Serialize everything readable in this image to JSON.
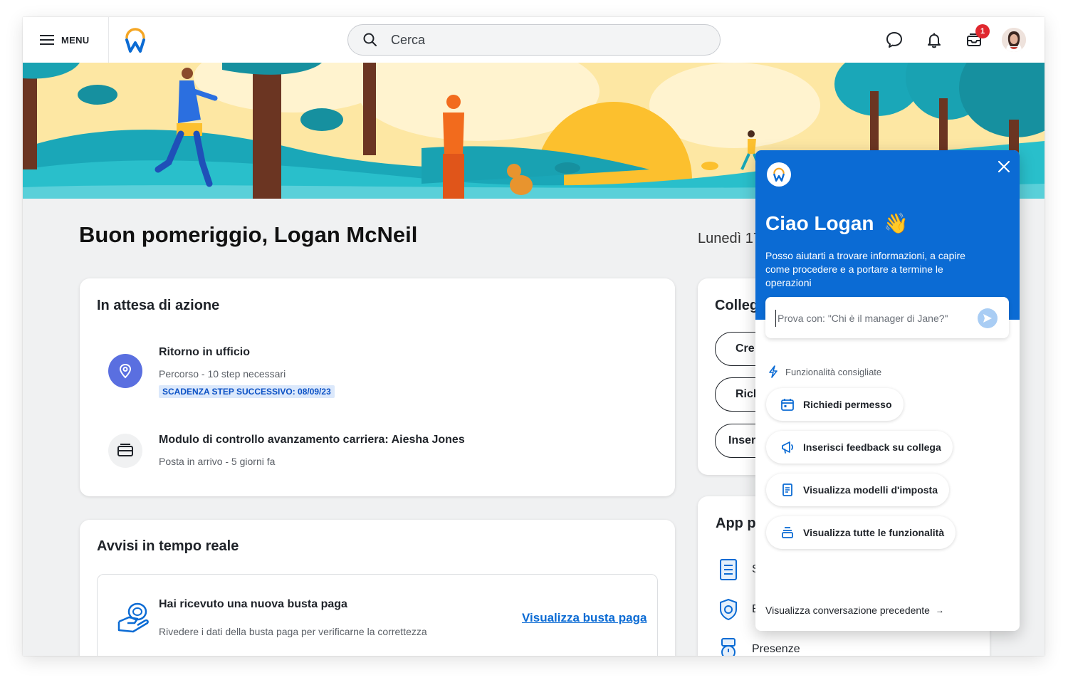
{
  "topbar": {
    "menu_label": "MENU",
    "search_placeholder": "Cerca",
    "inbox_badge": "1"
  },
  "greeting": "Buon pomeriggio, Logan McNeil",
  "date": "Lunedì 17",
  "awaiting": {
    "title": "In attesa di azione",
    "tasks": [
      {
        "title": "Ritorno in ufficio",
        "subtitle": "Percorso - 10 step necessari",
        "deadline": "SCADENZA STEP SUCCESSIVO: 08/09/23"
      },
      {
        "title": "Modulo di controllo avanzamento carriera: Aiesha Jones",
        "subtitle": "Posta in arrivo - 5 giorni fa"
      }
    ]
  },
  "alerts": {
    "title": "Avvisi in tempo reale",
    "items": [
      {
        "title": "Hai ricevuto una nuova busta paga",
        "subtitle": "Rivedere i dati della busta paga per verificarne la correttezza",
        "link": "Visualizza busta paga"
      }
    ]
  },
  "colleagues": {
    "title": "Colleg",
    "buttons": [
      "Cre",
      "Rich",
      "Inser"
    ]
  },
  "apps": {
    "title": "App pr",
    "items": [
      "S",
      "E",
      "Presenze"
    ]
  },
  "assistant": {
    "greeting": "Ciao Logan",
    "wave": "👋",
    "description": "Posso aiutarti a trovare informazioni, a capire come procedere e a portare a termine le operazioni",
    "input_placeholder": "Prova con: \"Chi è il manager di Jane?\"",
    "section_label": "Funzionalità consigliate",
    "chips": [
      {
        "label": "Richiedi permesso",
        "icon": "calendar-icon"
      },
      {
        "label": "Inserisci feedback su collega",
        "icon": "megaphone-icon"
      },
      {
        "label": "Visualizza modelli d'imposta",
        "icon": "document-icon"
      },
      {
        "label": "Visualizza tutte le funzionalità",
        "icon": "stack-icon"
      }
    ],
    "previous_conversation": "Visualizza conversazione precedente",
    "arrow": "→"
  },
  "colors": {
    "brand_blue": "#0b6bd4",
    "banner_sky": "#fde7a3",
    "banner_hill": "#1aa7b8",
    "badge_red": "#e0272e"
  }
}
